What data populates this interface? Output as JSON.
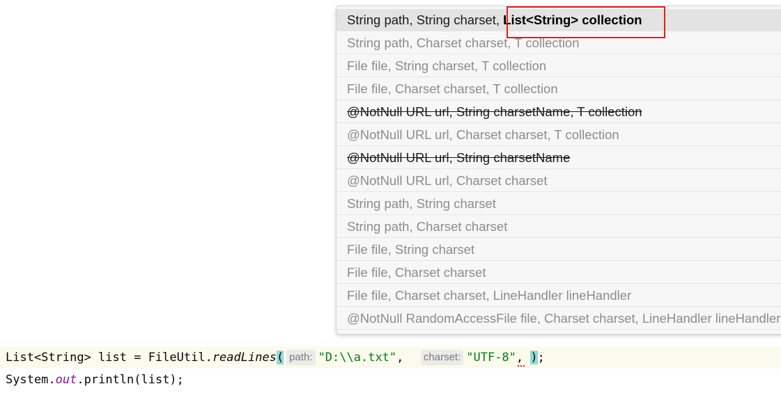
{
  "popup": {
    "signatures": [
      {
        "pre": "String path, String charset, ",
        "hl": "List<String> collection",
        "state": "current"
      },
      {
        "pre": "String path, Charset charset, T collection",
        "hl": "",
        "state": "normal"
      },
      {
        "pre": "File file, String charset, T collection",
        "hl": "",
        "state": "normal"
      },
      {
        "pre": "File file, Charset charset, T collection",
        "hl": "",
        "state": "normal"
      },
      {
        "pre": "@NotNull URL url, String charsetName, T collection",
        "hl": "",
        "state": "deprecated"
      },
      {
        "pre": "@NotNull URL url, Charset charset, T collection",
        "hl": "",
        "state": "normal"
      },
      {
        "pre": "@NotNull URL url, String charsetName",
        "hl": "",
        "state": "deprecated"
      },
      {
        "pre": "@NotNull URL url, Charset charset",
        "hl": "",
        "state": "normal"
      },
      {
        "pre": "String path, String charset",
        "hl": "",
        "state": "normal"
      },
      {
        "pre": "String path, Charset charset",
        "hl": "",
        "state": "normal"
      },
      {
        "pre": "File file, String charset",
        "hl": "",
        "state": "normal"
      },
      {
        "pre": "File file, Charset charset",
        "hl": "",
        "state": "normal"
      },
      {
        "pre": "File file, Charset charset, LineHandler lineHandler",
        "hl": "",
        "state": "normal"
      },
      {
        "pre": "@NotNull RandomAccessFile file, Charset charset, LineHandler lineHandler",
        "hl": "",
        "state": "normal"
      }
    ]
  },
  "code": {
    "line1": {
      "decl": "List<String> list = FileUtil.",
      "method": "readLines",
      "open_paren": "(",
      "hint_path": "path:",
      "arg_path": "\"D:\\\\a.txt\"",
      "comma1": ",",
      "hint_charset": "charset:",
      "arg_charset": "\"UTF-8\"",
      "comma2": ",",
      "space": " ",
      "close_paren": ")",
      "semicolon": ";"
    },
    "line2": {
      "prefix": "System.",
      "field": "out",
      "suffix": ".println(list);"
    }
  },
  "colors": {
    "string": "#067d17",
    "static_field": "#871094",
    "brace_match": "#93d9d9",
    "highlight_box": "#e02020"
  }
}
